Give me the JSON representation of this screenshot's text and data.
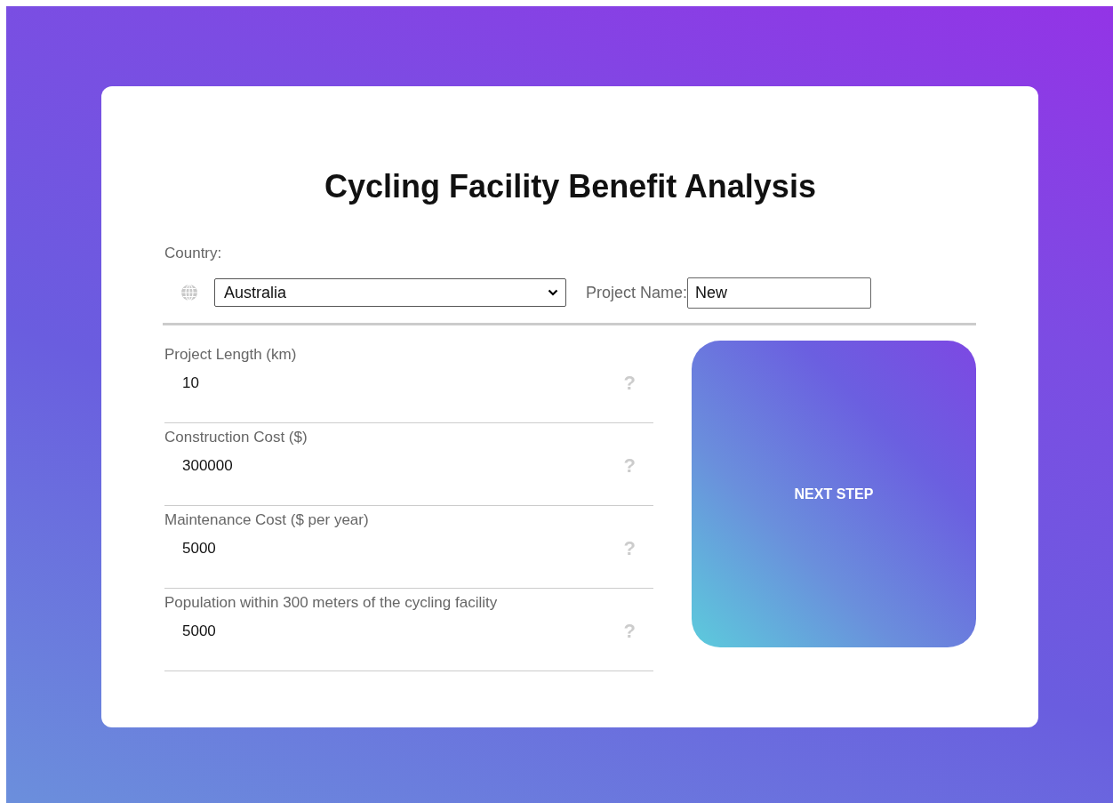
{
  "title": "Cycling Facility Benefit Analysis",
  "country": {
    "label": "Country:",
    "value": "Australia"
  },
  "project_name": {
    "label": "Project Name:",
    "value": "New"
  },
  "fields": [
    {
      "label": "Project Length (km)",
      "value": "10",
      "help": "?"
    },
    {
      "label": "Construction Cost ($)",
      "value": "300000",
      "help": "?"
    },
    {
      "label": "Maintenance Cost ($ per year)",
      "value": "5000",
      "help": "?"
    },
    {
      "label": "Population within 300 meters of the cycling facility",
      "value": "5000",
      "help": "?"
    }
  ],
  "next_button": "NEXT STEP"
}
